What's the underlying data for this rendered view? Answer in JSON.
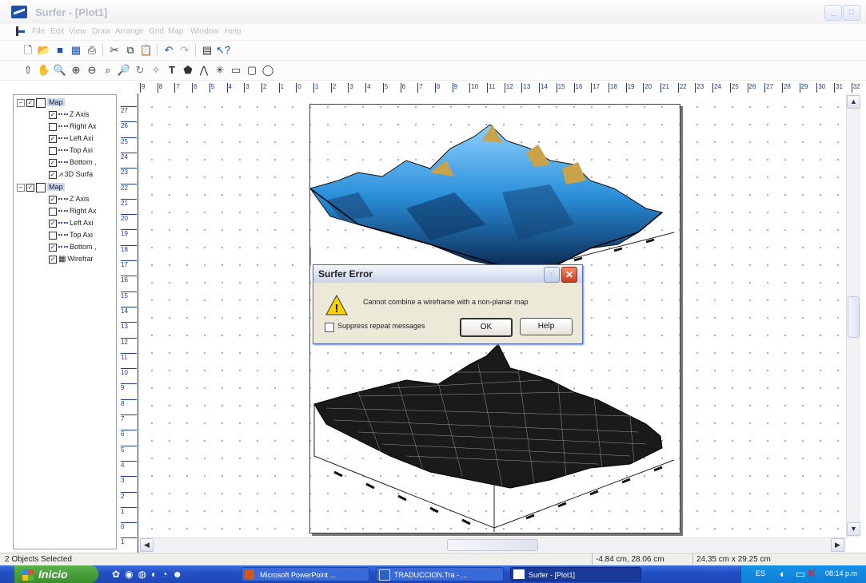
{
  "window": {
    "title": "Surfer - [Plot1]"
  },
  "menu": [
    "File",
    "Edit",
    "View",
    "Draw",
    "Arrange",
    "Grid",
    "Map",
    "Window",
    "Help"
  ],
  "ruler": {
    "h_labels": [
      "9",
      "8",
      "7",
      "6",
      "5",
      "4",
      "3",
      "2",
      "1",
      "0",
      "1",
      "2",
      "3",
      "4",
      "5",
      "6",
      "7",
      "8",
      "9",
      "10",
      "11",
      "12",
      "13",
      "14",
      "15",
      "16",
      "17",
      "18",
      "19",
      "20",
      "21",
      "22",
      "23",
      "24",
      "25",
      "26",
      "27",
      "28",
      "29",
      "30",
      "31",
      "32"
    ],
    "v_labels": [
      "27",
      "26",
      "25",
      "24",
      "23",
      "22",
      "21",
      "20",
      "19",
      "18",
      "17",
      "16",
      "15",
      "14",
      "13",
      "12",
      "11",
      "10",
      "9",
      "8",
      "7",
      "6",
      "5",
      "4",
      "3",
      "2",
      "1",
      "0",
      "1"
    ]
  },
  "tree": [
    {
      "label": "Map",
      "level": 0,
      "type": "map",
      "selected": true
    },
    {
      "label": "Z Axis",
      "level": 1,
      "checked": true,
      "type": "axis"
    },
    {
      "label": "Right Ax",
      "level": 1,
      "checked": false,
      "type": "axis"
    },
    {
      "label": "Left Axi",
      "level": 1,
      "checked": true,
      "type": "axis"
    },
    {
      "label": "Top Axi",
      "level": 1,
      "checked": false,
      "type": "axis"
    },
    {
      "label": "Bottom ,",
      "level": 1,
      "checked": true,
      "type": "axis"
    },
    {
      "label": "3D Surfa",
      "level": 1,
      "checked": true,
      "type": "surface"
    },
    {
      "label": "Map",
      "level": 0,
      "type": "map",
      "selected": true
    },
    {
      "label": "Z Axis",
      "level": 1,
      "checked": true,
      "type": "axis"
    },
    {
      "label": "Right Ax",
      "level": 1,
      "checked": false,
      "type": "axis"
    },
    {
      "label": "Left Axi",
      "level": 1,
      "checked": true,
      "type": "axis"
    },
    {
      "label": "Top Axi",
      "level": 1,
      "checked": false,
      "type": "axis"
    },
    {
      "label": "Bottom ,",
      "level": 1,
      "checked": true,
      "type": "axis"
    },
    {
      "label": "Wirefrar",
      "level": 1,
      "checked": true,
      "type": "wireframe"
    }
  ],
  "dialog": {
    "title": "Surfer Error",
    "message": "Cannot combine a wireframe with a non-planar map",
    "checkbox_label": "Suppress repeat messages",
    "ok": "OK",
    "help": "Help"
  },
  "status": {
    "selection": "2 Objects Selected",
    "position": "-4.84 cm, 28.06 cm",
    "size": "24.35 cm x 29.25 cm"
  },
  "taskbar": {
    "start": "Inicio",
    "tasks": [
      "Microsoft PowerPoint ...",
      "TRADUCCION.Tra - ...",
      "Surfer - [Plot1]"
    ],
    "lang": "ES",
    "time": "08:14 p.m"
  },
  "colors": {
    "selection": "#c7d7f5",
    "taskbar": "#2350c6",
    "start": "#3a8e2b",
    "surface_blue": "#2a8fd8",
    "surface_gold": "#c9a24a"
  }
}
